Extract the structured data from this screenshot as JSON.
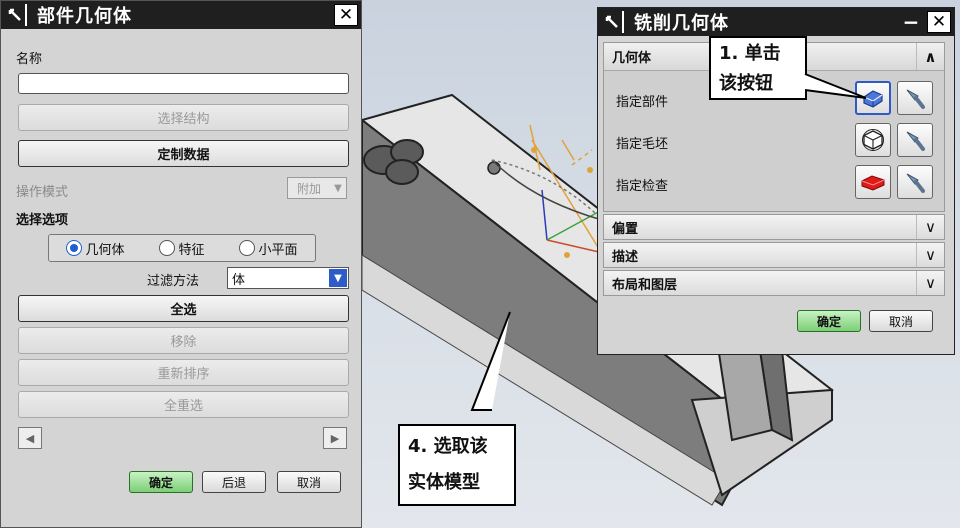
{
  "left_dialog": {
    "title": "部件几何体",
    "name_label": "名称",
    "name_value": "",
    "select_structure_button": "选择结构",
    "custom_data_button": "定制数据",
    "operation_mode_label": "操作模式",
    "operation_mode_value": "附加",
    "selection_options_label": "选择选项",
    "radio_options": [
      "几何体",
      "特征",
      "小平面"
    ],
    "radio_selected": "几何体",
    "filter_label": "过滤方法",
    "filter_value": "体",
    "select_all_button": "全选",
    "remove_button": "移除",
    "reorder_button": "重新排序",
    "reselect_all_button": "全重选",
    "ok_button": "确定",
    "back_button": "后退",
    "cancel_button": "取消"
  },
  "right_dialog": {
    "title": "铣削几何体",
    "geometry_section": "几何体",
    "rows": [
      {
        "label": "指定部件",
        "icon": "part-icon"
      },
      {
        "label": "指定毛坯",
        "icon": "blank-cube-icon"
      },
      {
        "label": "指定检查",
        "icon": "check-body-icon"
      }
    ],
    "collapsed_sections": [
      "偏置",
      "描述",
      "布局和图层"
    ],
    "ok_button": "确定",
    "cancel_button": "取消"
  },
  "callouts": {
    "step1_line1": "1. 单击",
    "step1_line2": "该按钮",
    "step4_line1": "4. 选取该",
    "step4_line2": "实体模型"
  },
  "colors": {
    "titlebar": "#1f1f1f",
    "ok_green": "#7ccf76",
    "radio_blue": "#1f5fd0",
    "viewport_bg": "#d3dae4",
    "model_gray": "#8e8e8e"
  }
}
